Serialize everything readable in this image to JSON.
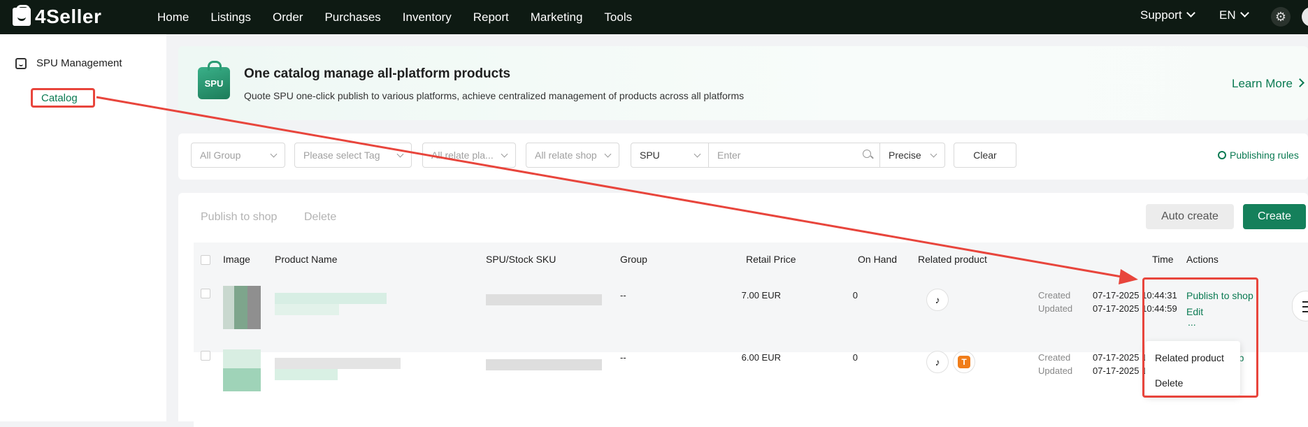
{
  "brand": {
    "name": "4Seller"
  },
  "nav": {
    "items": [
      "Home",
      "Listings",
      "Order",
      "Purchases",
      "Inventory",
      "Report",
      "Marketing",
      "Tools"
    ]
  },
  "topright": {
    "support": "Support",
    "language": "EN"
  },
  "sidebar": {
    "section": "SPU Management",
    "items": [
      {
        "label": "Catalog",
        "active": true
      }
    ]
  },
  "banner": {
    "icon_text": "SPU",
    "title": "One catalog manage all-platform products",
    "description": "Quote SPU one-click publish to various platforms, achieve centralized management of products across all platforms",
    "learn_more": "Learn More"
  },
  "filters": {
    "group": "All Group",
    "tag_placeholder": "Please select Tag",
    "relate_platform": "All relate pla...",
    "relate_shop": "All relate shop",
    "search_field": "SPU",
    "search_placeholder": "Enter",
    "match_mode": "Precise",
    "clear": "Clear",
    "publishing_rules": "Publishing rules"
  },
  "toolbar": {
    "publish_to_shop": "Publish to shop",
    "delete": "Delete",
    "auto_create": "Auto create",
    "create": "Create"
  },
  "table": {
    "columns": {
      "image": "Image",
      "product_name": "Product Name",
      "spu_sku": "SPU/Stock SKU",
      "group": "Group",
      "retail_price": "Retail Price",
      "on_hand": "On Hand",
      "related_product": "Related product",
      "time": "Time",
      "actions": "Actions"
    },
    "rows": [
      {
        "group": "--",
        "retail_price": "7.00 EUR",
        "on_hand": "0",
        "platforms": [
          "tiktok-icon"
        ],
        "created_label": "Created",
        "created": "07-17-2025 10:44:31",
        "updated_label": "Updated",
        "updated": "07-17-2025 10:44:59",
        "actions": {
          "publish": "Publish to shop",
          "edit": "Edit",
          "more": "..."
        }
      },
      {
        "group": "--",
        "retail_price": "6.00 EUR",
        "on_hand": "0",
        "platforms": [
          "tiktok-icon",
          "temu-icon"
        ],
        "created_label": "Created",
        "created": "07-17-2025 1",
        "updated_label": "Updated",
        "updated": "07-17-2025 1",
        "actions": {
          "publish_partial": "hop",
          "more": "..."
        }
      }
    ]
  },
  "more_menu": {
    "items": [
      "Related product",
      "Delete"
    ]
  },
  "icons": {
    "platform_1": "tiktok-icon",
    "platform_2": "temu-icon",
    "temu_glyph": "T"
  },
  "colors": {
    "brand_green": "#15805b",
    "link_green": "#0a7a52",
    "annotation_red": "#e8453c",
    "topbar": "#0e1a13"
  }
}
